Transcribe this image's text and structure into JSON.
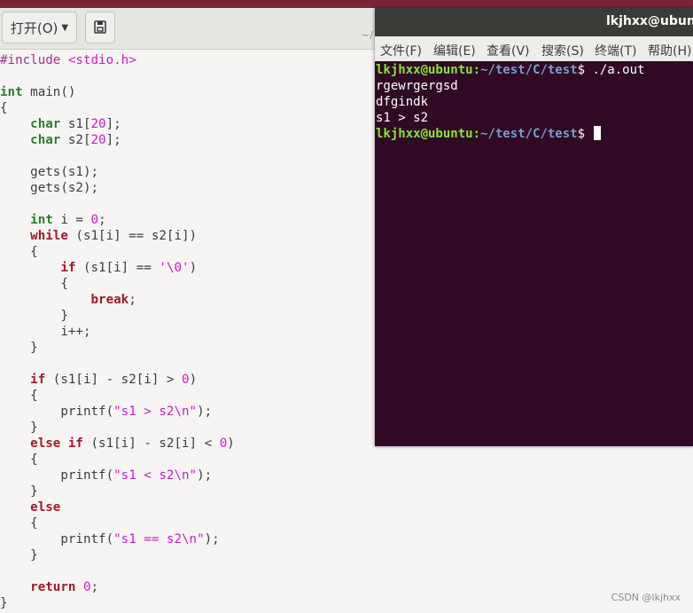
{
  "editor": {
    "open_label": "打开(O)",
    "path_hint": "~/",
    "code_lines": [
      [
        [
          "pp",
          "#include "
        ],
        [
          "str",
          "<stdio.h>"
        ]
      ],
      [],
      [
        [
          "ty",
          "int"
        ],
        [
          "plain",
          " main()"
        ]
      ],
      [
        [
          "plain",
          "{"
        ]
      ],
      [
        [
          "plain",
          "    "
        ],
        [
          "ty",
          "char"
        ],
        [
          "plain",
          " s1["
        ],
        [
          "num",
          "20"
        ],
        [
          "plain",
          "];"
        ]
      ],
      [
        [
          "plain",
          "    "
        ],
        [
          "ty",
          "char"
        ],
        [
          "plain",
          " s2["
        ],
        [
          "num",
          "20"
        ],
        [
          "plain",
          "];"
        ]
      ],
      [],
      [
        [
          "plain",
          "    gets(s1);"
        ]
      ],
      [
        [
          "plain",
          "    gets(s2);"
        ]
      ],
      [],
      [
        [
          "plain",
          "    "
        ],
        [
          "ty",
          "int"
        ],
        [
          "plain",
          " i = "
        ],
        [
          "num",
          "0"
        ],
        [
          "plain",
          ";"
        ]
      ],
      [
        [
          "plain",
          "    "
        ],
        [
          "kw",
          "while"
        ],
        [
          "plain",
          " (s1[i] == s2[i])"
        ]
      ],
      [
        [
          "plain",
          "    {"
        ]
      ],
      [
        [
          "plain",
          "        "
        ],
        [
          "kw",
          "if"
        ],
        [
          "plain",
          " (s1[i] == "
        ],
        [
          "str",
          "'\\0'"
        ],
        [
          "plain",
          ")"
        ]
      ],
      [
        [
          "plain",
          "        {"
        ]
      ],
      [
        [
          "plain",
          "            "
        ],
        [
          "kw",
          "break"
        ],
        [
          "plain",
          ";"
        ]
      ],
      [
        [
          "plain",
          "        }"
        ]
      ],
      [
        [
          "plain",
          "        i++;"
        ]
      ],
      [
        [
          "plain",
          "    }"
        ]
      ],
      [],
      [
        [
          "plain",
          "    "
        ],
        [
          "kw",
          "if"
        ],
        [
          "plain",
          " (s1[i] - s2[i] > "
        ],
        [
          "num",
          "0"
        ],
        [
          "plain",
          ")"
        ]
      ],
      [
        [
          "plain",
          "    {"
        ]
      ],
      [
        [
          "plain",
          "        printf("
        ],
        [
          "str",
          "\"s1 > s2\\n\""
        ],
        [
          "plain",
          ");"
        ]
      ],
      [
        [
          "plain",
          "    }"
        ]
      ],
      [
        [
          "plain",
          "    "
        ],
        [
          "kw",
          "else if"
        ],
        [
          "plain",
          " (s1[i] - s2[i] < "
        ],
        [
          "num",
          "0"
        ],
        [
          "plain",
          ")"
        ]
      ],
      [
        [
          "plain",
          "    {"
        ]
      ],
      [
        [
          "plain",
          "        printf("
        ],
        [
          "str",
          "\"s1 < s2\\n\""
        ],
        [
          "plain",
          ");"
        ]
      ],
      [
        [
          "plain",
          "    }"
        ]
      ],
      [
        [
          "plain",
          "    "
        ],
        [
          "kw",
          "else"
        ]
      ],
      [
        [
          "plain",
          "    {"
        ]
      ],
      [
        [
          "plain",
          "        printf("
        ],
        [
          "str",
          "\"s1 == s2\\n\""
        ],
        [
          "plain",
          ");"
        ]
      ],
      [
        [
          "plain",
          "    }"
        ]
      ],
      [],
      [
        [
          "plain",
          "    "
        ],
        [
          "kw",
          "return"
        ],
        [
          "plain",
          " "
        ],
        [
          "num",
          "0"
        ],
        [
          "plain",
          ";"
        ]
      ],
      [
        [
          "plain",
          "}"
        ]
      ]
    ]
  },
  "terminal": {
    "title": "lkjhxx@ubunt",
    "menu": [
      "文件(F)",
      "编辑(E)",
      "查看(V)",
      "搜索(S)",
      "终端(T)",
      "帮助(H)"
    ],
    "user_host": "lkjhxx@ubuntu",
    "path": "~/test/C/test",
    "command": "./a.out",
    "output": [
      "rgewrgergsd",
      "dfgindk",
      "s1 > s2"
    ]
  },
  "watermark": "CSDN @lkjhxx",
  "colors": {
    "terminal_bg": "#300a24",
    "prompt_user": "#8ae234",
    "prompt_path": "#729fcf",
    "keyword": "#a3192b",
    "type": "#2e7d32",
    "literal": "#c81fbf"
  }
}
